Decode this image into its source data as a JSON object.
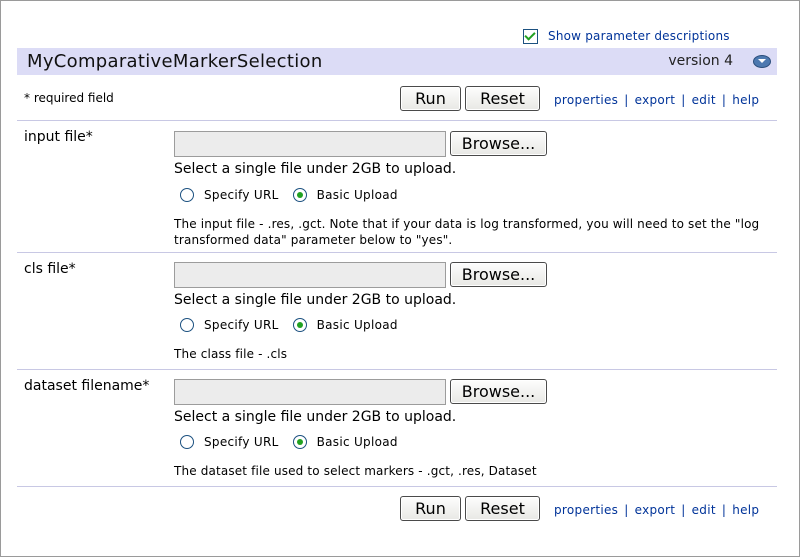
{
  "header": {
    "show_descriptions_label": "Show parameter descriptions",
    "show_descriptions_checked": true,
    "module_name": "MyComparativeMarkerSelection",
    "version": "version 4"
  },
  "toolbar": {
    "required_note": "* required field",
    "run_label": "Run",
    "reset_label": "Reset",
    "links": [
      "properties",
      "export",
      "edit",
      "help"
    ],
    "separator": "|"
  },
  "file_input": {
    "browse_label": "Browse...",
    "upload_hint": "Select a single file under 2GB to upload.",
    "radio_url": "Specify URL",
    "radio_upload": "Basic Upload",
    "selected": "Basic Upload"
  },
  "params": [
    {
      "label": "input file*",
      "description": "The input file - .res, .gct. Note that if your data is log transformed, you will need to set the \"log transformed data\" parameter below to \"yes\"."
    },
    {
      "label": "cls file*",
      "description": "The class file - .cls"
    },
    {
      "label": "dataset filename*",
      "description": "The dataset file used to select markers - .gct, .res, Dataset"
    }
  ],
  "colors": {
    "title_bar": "#dcdcf6",
    "link": "#003399",
    "check": "#21a121",
    "divider": "#c8c8e4"
  }
}
